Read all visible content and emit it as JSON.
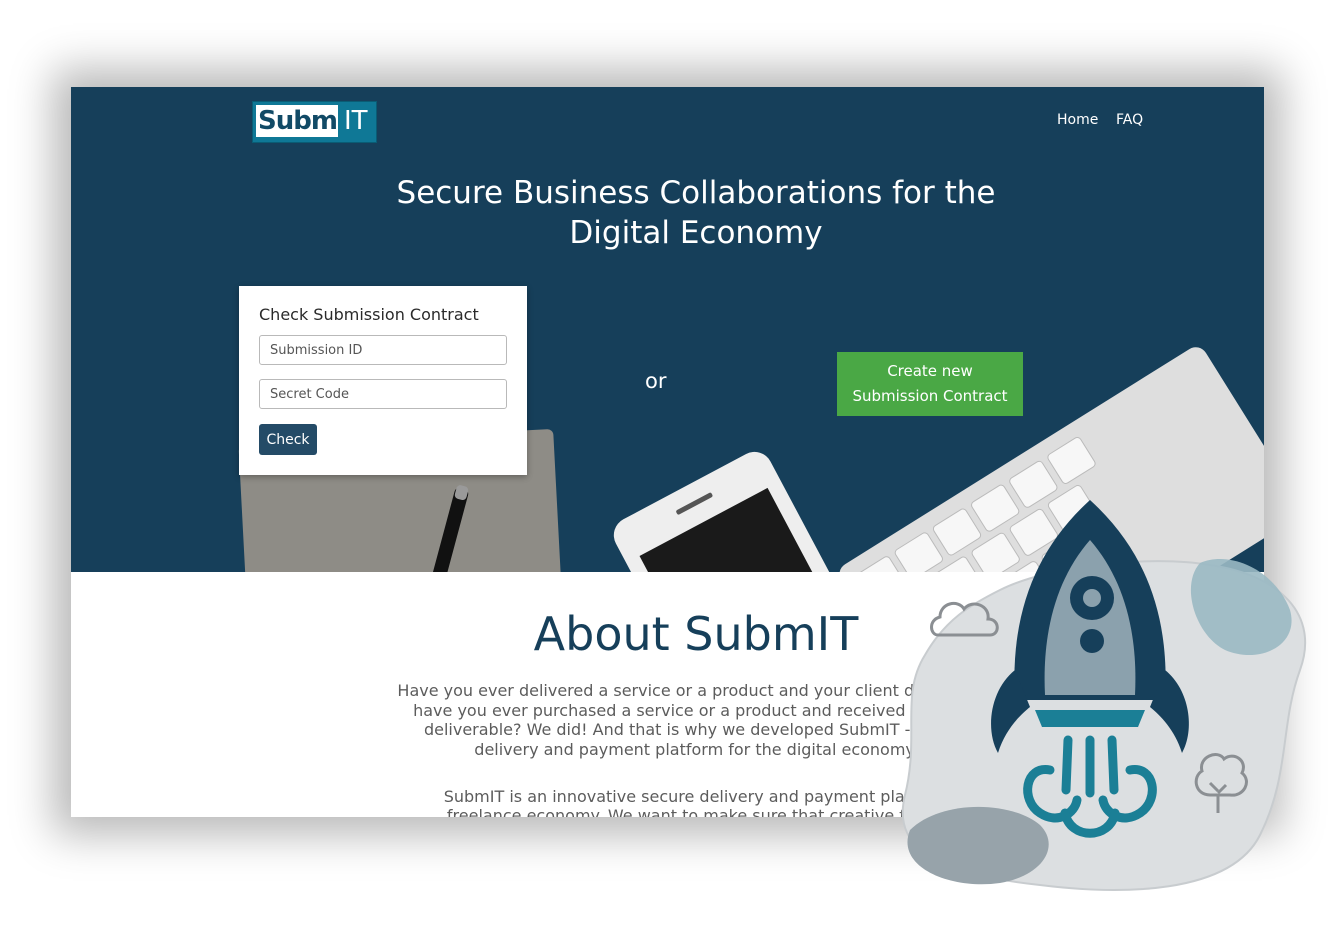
{
  "header": {
    "logo_left": "Subm",
    "logo_right": "IT",
    "nav": [
      {
        "label": "Home"
      },
      {
        "label": "FAQ"
      }
    ]
  },
  "hero": {
    "headline_line1": "Secure Business Collaborations for the",
    "headline_line2": "Digital Economy",
    "check_card": {
      "title": "Check Submission Contract",
      "submission_id_placeholder": "Submission ID",
      "secret_code_placeholder": "Secret Code",
      "check_label": "Check"
    },
    "or_label": "or",
    "create_line1": "Create new",
    "create_line2": "Submission Contract"
  },
  "about": {
    "title": "About SubmIT",
    "p1_lines": [
      "Have you ever delivered a service or a product and your client did not pay",
      "have you ever purchased a service or a product and received a low-qu",
      "deliverable? We did! And that is why we developed SubmIT - Our se",
      "delivery and payment platform for the digital economy."
    ],
    "p2_lines": [
      "SubmIT is an innovative secure delivery and payment platform",
      "freelance economy. We want to make sure that creative freela"
    ]
  },
  "colors": {
    "hero_bg": "#163f5a",
    "accent_green": "#4aa845",
    "logo_teal": "#0f7896",
    "rocket_dark": "#163f5a",
    "rocket_teal": "#1b7f96"
  }
}
